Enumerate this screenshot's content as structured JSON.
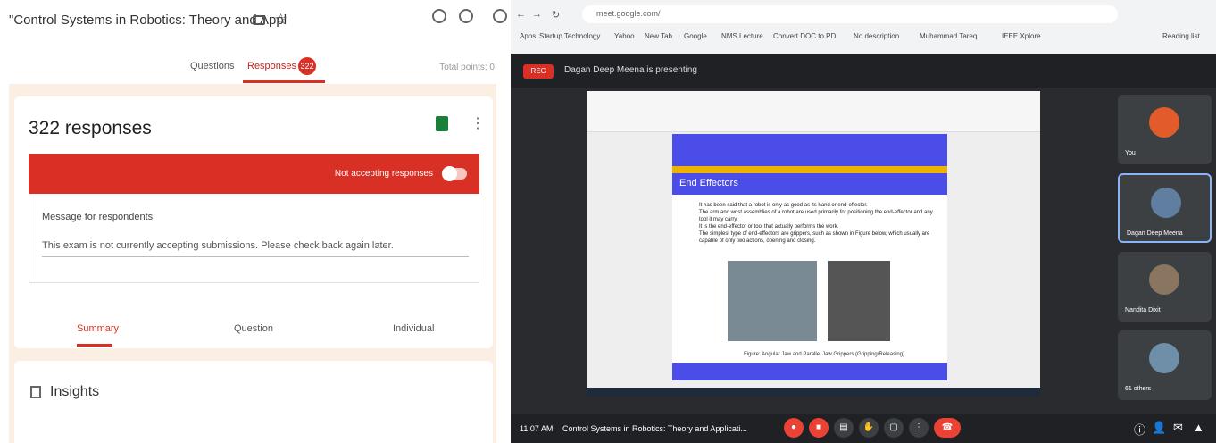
{
  "form": {
    "title": "\"Control Systems in Robotics: Theory and Appl",
    "tabs": {
      "questions": "Questions",
      "responses": "Responses",
      "count": "322"
    },
    "total_points": "Total points: 0",
    "responses_heading": "322 responses",
    "accepting_label": "Not accepting responses",
    "message_title": "Message for respondents",
    "message_text": "This exam is not currently accepting submissions. Please check back again later.",
    "sub_tabs": [
      "Summary",
      "Question",
      "Individual"
    ],
    "insights": "Insights"
  },
  "browser": {
    "url": "meet.google.com/",
    "bookmarks": [
      "Apps",
      "Startup Technology",
      "Yahoo",
      "New Tab",
      "Google",
      "NMS Lecture",
      "Convert DOC to PD",
      "No description",
      "Muhammad Tareq",
      "IEEE Xplore",
      "Reading list"
    ]
  },
  "meet": {
    "rec": "REC",
    "presenting": "Dagan Deep Meena is presenting",
    "slide_title": "End Effectors",
    "slide_bullets": [
      "It has been said that a robot is only as good as its hand or end-effector.",
      "The arm and wrist assemblies of a robot are used primarily for positioning the end-effector and any tool it may carry.",
      "It is the end-effector or tool that actually performs the work.",
      "The simplest type of end-effectors are grippers, such as shown in Figure below, which usually are capable of only two actions, opening and closing."
    ],
    "slide_caption": "Figure: Angular Jaw and Parallel Jaw Grippers (Gripping/Releasing)",
    "participants": [
      {
        "name": "You",
        "color": "#e25b2a"
      },
      {
        "name": "Dagan Deep Meena",
        "color": "#5f7ea0"
      },
      {
        "name": "Nandita Dixit",
        "color": "#8a7560"
      },
      {
        "name": "61 others",
        "color": "#6f8fa8"
      }
    ],
    "time": "11:07 AM",
    "meeting_title": "Control Systems in Robotics: Theory and Applicati..."
  }
}
